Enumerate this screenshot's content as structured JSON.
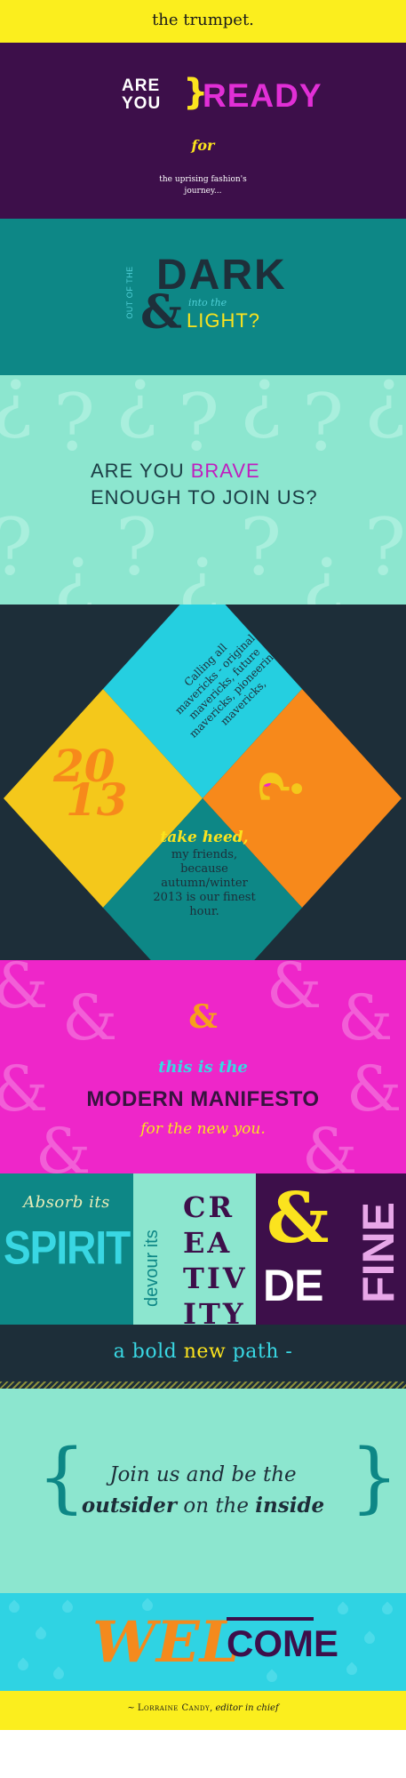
{
  "header": {
    "title": "the trumpet."
  },
  "ready": {
    "are": "ARE",
    "you": "YOU",
    "brace": "}",
    "ready": "READY",
    "for": "for",
    "subtitle_line1": "the uprising fashion's",
    "subtitle_line2": "journey..."
  },
  "dark": {
    "out_of_the": "OUT OF THE",
    "dark": "DARK",
    "ampersand": "&",
    "into_the": "into the",
    "light": "LIGHT?"
  },
  "brave": {
    "line1_prefix": "ARE YOU ",
    "line1_highlight": "BRAVE",
    "line2": "ENOUGH TO JOIN US?"
  },
  "diamond": {
    "calling_lines": [
      "Calling all",
      "mavericks - original",
      "mavericks, future",
      "mavericks, pioneering",
      "mavericks,"
    ],
    "year_top": "20",
    "year_bottom": "13",
    "take_heed": "take heed,",
    "heed_lines": [
      "my friends,",
      "because",
      "autumn/winter",
      "2013 is our finest",
      "hour."
    ]
  },
  "manifesto": {
    "ampersand": "&",
    "this_is_the": "this is the",
    "modern": "MODERN MANIFESTO",
    "for_you": "for the new you."
  },
  "grid": {
    "absorb": "Absorb its",
    "spirit": "SPIRIT",
    "devour": "devour its",
    "creativity_rows": [
      "CR",
      "EA",
      "TIV",
      "ITY"
    ],
    "ampersand": "&",
    "de": "DE",
    "fine": "FINE"
  },
  "bold": {
    "prefix": "a bold ",
    "highlight": "new",
    "suffix": " path -"
  },
  "join": {
    "line1": "Join us and be the",
    "outsider": "outsider",
    "middle": " on the ",
    "inside": "inside"
  },
  "welcome": {
    "part1": "WEL",
    "part2": "COME"
  },
  "footer": {
    "prefix": "~ ",
    "name": "Lorraine Candy",
    "role": "editor in chief"
  },
  "colors": {
    "yellow": "#fbee1e",
    "purple": "#3d0f4a",
    "teal": "#0d8786",
    "mint": "#8ce6cf",
    "navy": "#1d2e39",
    "cyan": "#2fd3e3",
    "magenta": "#ee26c9",
    "orange": "#f7a01a"
  }
}
